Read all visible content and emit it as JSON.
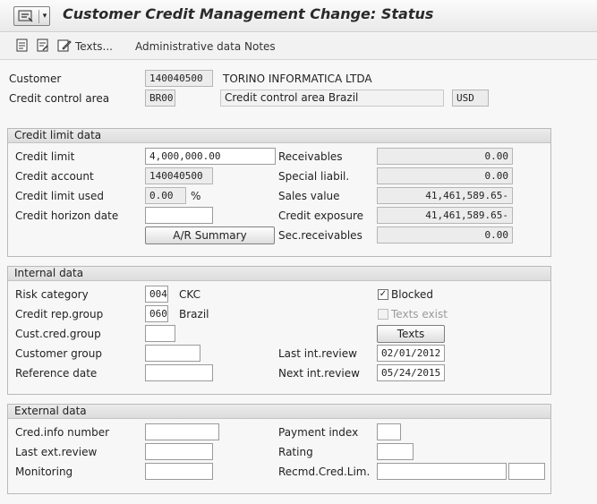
{
  "window": {
    "title": "Customer Credit Management Change: Status"
  },
  "toolbar": {
    "texts_label": "Texts...",
    "admin_label": "Administrative data",
    "notes_label": "Notes"
  },
  "header": {
    "customer_label": "Customer",
    "customer_value": "140040500",
    "customer_name": "TORINO INFORMATICA LTDA",
    "cca_label": "Credit control area",
    "cca_value": "BR00",
    "cca_name": "Credit control area Brazil",
    "currency": "USD"
  },
  "credit_limit_data": {
    "title": "Credit limit data",
    "credit_limit_label": "Credit limit",
    "credit_limit_value": "4,000,000.00",
    "credit_account_label": "Credit account",
    "credit_account_value": "140040500",
    "credit_used_label": "Credit limit used",
    "credit_used_value": "0.00",
    "credit_used_unit": "%",
    "horizon_label": "Credit horizon date",
    "horizon_value": "",
    "ar_summary_button": "A/R Summary",
    "receivables_label": "Receivables",
    "receivables_value": "0.00",
    "special_label": "Special liabil.",
    "special_value": "0.00",
    "sales_label": "Sales value",
    "sales_value": "41,461,589.65-",
    "exposure_label": "Credit exposure",
    "exposure_value": "41,461,589.65-",
    "sec_label": "Sec.receivables",
    "sec_value": "0.00"
  },
  "internal_data": {
    "title": "Internal data",
    "risk_label": "Risk category",
    "risk_value": "004",
    "risk_text": "CKC",
    "rep_label": "Credit rep.group",
    "rep_value": "060",
    "rep_text": "Brazil",
    "cust_cred_label": "Cust.cred.group",
    "cust_cred_value": "",
    "cust_group_label": "Customer group",
    "cust_group_value": "",
    "ref_date_label": "Reference date",
    "ref_date_value": "",
    "blocked_label": "Blocked",
    "texts_exist_label": "Texts exist",
    "texts_button": "Texts",
    "last_review_label": "Last int.review",
    "last_review_value": "02/01/2012",
    "next_review_label": "Next int.review",
    "next_review_value": "05/24/2015"
  },
  "external_data": {
    "title": "External data",
    "cred_info_label": "Cred.info number",
    "cred_info_value": "",
    "last_ext_label": "Last ext.review",
    "last_ext_value": "",
    "monitoring_label": "Monitoring",
    "monitoring_value": "",
    "payment_index_label": "Payment index",
    "payment_index_value": "",
    "rating_label": "Rating",
    "rating_value": "",
    "recmd_label": "Recmd.Cred.Lim.",
    "recmd_value": "",
    "recmd_currency": ""
  }
}
